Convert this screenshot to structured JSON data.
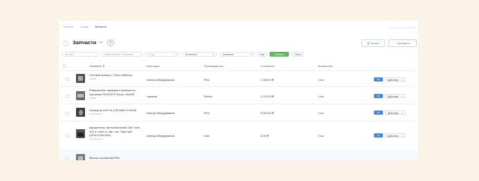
{
  "breadcrumbs": {
    "home": "Главная",
    "separator1": "›",
    "section": "Склад",
    "separator2": "›",
    "current": "Запчасти"
  },
  "header": {
    "right_hint": "Дополнительные настройки",
    "back_icon": "‹",
    "title": "Запчасти",
    "title_icon1": "⇄",
    "title_icon2": "⎘"
  },
  "buttons": {
    "print": "⎙ Печать",
    "add": "+ Добавить"
  },
  "filters": {
    "article_placeholder": "Артикул",
    "name_placeholder": "Наименование / Описание",
    "warehouse_placeholder": "Склад",
    "stock_value": "В наличии",
    "status_value": "Активные",
    "chevron": "▾",
    "more_label": "Еще",
    "show_label": "Показать",
    "reset_label": "Сброс"
  },
  "table": {
    "headers": {
      "name": "Название ▼",
      "category": "Категория",
      "manufacturer": "Производитель",
      "price": "Стоимость",
      "quantity": "Количество"
    },
    "tag_label": "84",
    "actions_label": "Действия",
    "rows": [
      {
        "name": "Силовой провод + Плюс (Кабель)",
        "code": "104/183",
        "category": "электрооборудование",
        "manufacturer": "PSA",
        "price": "1 000,00 ₽",
        "quantity": "1 шт."
      },
      {
        "name": "Ремкомплект переднего суппорта (с поршнем) PEUGEOT Boxer 244095",
        "code": "244095",
        "category": "тормоза",
        "manufacturer": "Pierrot",
        "price": "1 100,00 ₽",
        "quantity": "1 шт."
      },
      {
        "name": "Генератор BOX III (150 AMP) EURO5",
        "code": "10 40 433 60",
        "category": "электрооборудование",
        "manufacturer": "PSA",
        "price": "5 000,00 ₽",
        "quantity": "1 шт."
      },
      {
        "name": "Аккумулятор автомобильный Zubr Ultra 100 А·ч 840 А, обр. пол. Евро акб (ZESU17841360)",
        "code": "Аккумуляторы",
        "category": "электрооборудование",
        "manufacturer": "Zubr",
        "price": "0,00 ₽",
        "quantity": "1 шт."
      },
      {
        "name": "Фильтр топливный PSA",
        "code": "",
        "category": "",
        "manufacturer": "",
        "price": "",
        "quantity": ""
      }
    ]
  }
}
